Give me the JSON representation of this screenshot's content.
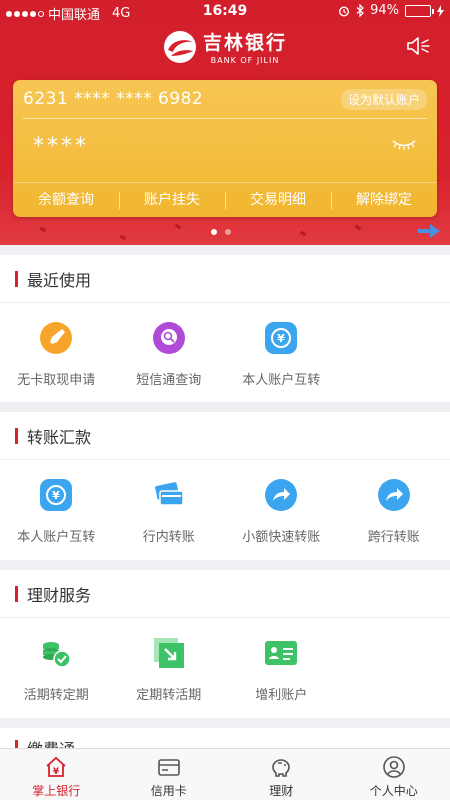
{
  "status_bar": {
    "carrier": "中国联通",
    "network": "4G",
    "time": "16:49",
    "battery_text": "94%",
    "battery_level": 0.94
  },
  "header": {
    "bank_name_cn": "吉林银行",
    "bank_name_en": "BANK OF JILIN"
  },
  "card": {
    "number": "6231 **** **** 6982",
    "set_default_label": "设为默认账户",
    "balance_masked": "****",
    "actions": [
      "余额查询",
      "账户挂失",
      "交易明细",
      "解除绑定"
    ],
    "active_page": 1,
    "page_count": 2
  },
  "sections": [
    {
      "title": "最近使用",
      "items": [
        {
          "label": "无卡取现申请",
          "icon": "cardless-withdraw-icon"
        },
        {
          "label": "短信通查询",
          "icon": "sms-query-icon"
        },
        {
          "label": "本人账户互转",
          "icon": "own-transfer-icon"
        }
      ]
    },
    {
      "title": "转账汇款",
      "items": [
        {
          "label": "本人账户互转",
          "icon": "own-transfer-icon"
        },
        {
          "label": "行内转账",
          "icon": "intrabank-transfer-icon"
        },
        {
          "label": "小额快速转账",
          "icon": "quick-transfer-icon"
        },
        {
          "label": "跨行转账",
          "icon": "interbank-transfer-icon"
        }
      ]
    },
    {
      "title": "理财服务",
      "items": [
        {
          "label": "活期转定期",
          "icon": "demand-to-fixed-icon"
        },
        {
          "label": "定期转活期",
          "icon": "fixed-to-demand-icon"
        },
        {
          "label": "增利账户",
          "icon": "bonus-account-icon"
        }
      ]
    },
    {
      "title": "缴费通"
    }
  ],
  "tabbar": [
    {
      "label": "掌上银行",
      "icon": "home-bank-icon",
      "active": true
    },
    {
      "label": "信用卡",
      "icon": "credit-card-icon",
      "active": false
    },
    {
      "label": "理财",
      "icon": "piggy-bank-icon",
      "active": false
    },
    {
      "label": "个人中心",
      "icon": "user-icon",
      "active": false
    }
  ],
  "colors": {
    "brand_red": "#d8222e",
    "card_gold": "#f1b62f",
    "icon_blue": "#3ba5f0",
    "icon_green": "#3dc267",
    "icon_orange": "#f7a52a",
    "icon_purple": "#b04bd8"
  }
}
